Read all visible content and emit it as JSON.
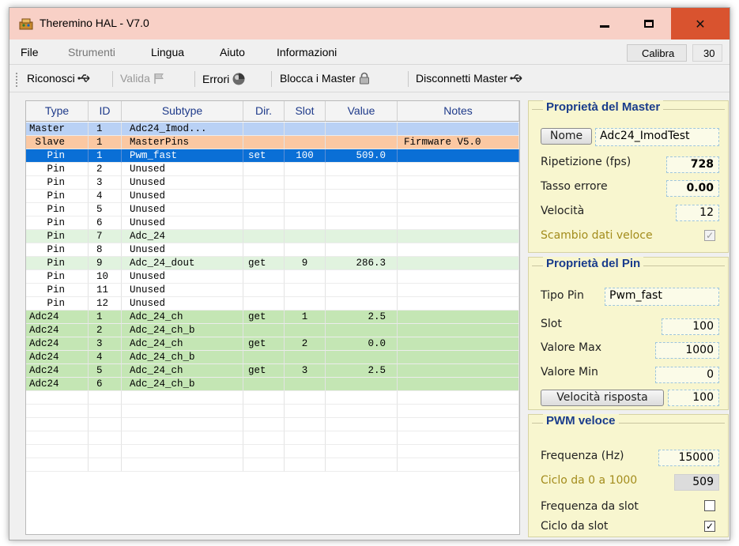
{
  "window": {
    "title": "Theremino HAL - V7.0"
  },
  "menu": {
    "items": [
      "File",
      "Strumenti",
      "Lingua",
      "Aiuto",
      "Informazioni"
    ],
    "calibra_label": "Calibra",
    "calibra_value": "30"
  },
  "toolbar": {
    "riconosci": "Riconosci",
    "valida": "Valida",
    "errori": "Errori",
    "blocca": "Blocca i Master",
    "disconnetti": "Disconnetti Master"
  },
  "table": {
    "headers": [
      "Type",
      "ID",
      "Subtype",
      "Dir.",
      "Slot",
      "Value",
      "Notes"
    ],
    "rows": [
      [
        "Master",
        "1",
        "Adc24_Imod...",
        "",
        "",
        "",
        ""
      ],
      [
        " Slave",
        "1",
        "MasterPins",
        "",
        "",
        "",
        "Firmware V5.0"
      ],
      [
        "   Pin",
        "1",
        "Pwm_fast",
        "set",
        "100",
        "509.0",
        ""
      ],
      [
        "   Pin",
        "2",
        "Unused",
        "",
        "",
        "",
        ""
      ],
      [
        "   Pin",
        "3",
        "Unused",
        "",
        "",
        "",
        ""
      ],
      [
        "   Pin",
        "4",
        "Unused",
        "",
        "",
        "",
        ""
      ],
      [
        "   Pin",
        "5",
        "Unused",
        "",
        "",
        "",
        ""
      ],
      [
        "   Pin",
        "6",
        "Unused",
        "",
        "",
        "",
        ""
      ],
      [
        "   Pin",
        "7",
        "Adc_24",
        "",
        "",
        "",
        ""
      ],
      [
        "   Pin",
        "8",
        "Unused",
        "",
        "",
        "",
        ""
      ],
      [
        "   Pin",
        "9",
        "Adc_24_dout",
        "get",
        "9",
        "286.3",
        ""
      ],
      [
        "   Pin",
        "10",
        "Unused",
        "",
        "",
        "",
        ""
      ],
      [
        "   Pin",
        "11",
        "Unused",
        "",
        "",
        "",
        ""
      ],
      [
        "   Pin",
        "12",
        "Unused",
        "",
        "",
        "",
        ""
      ],
      [
        "Adc24",
        "1",
        "Adc_24_ch",
        "get",
        "1",
        "2.5",
        ""
      ],
      [
        "Adc24",
        "2",
        "Adc_24_ch_b",
        "",
        "",
        "",
        ""
      ],
      [
        "Adc24",
        "3",
        "Adc_24_ch",
        "get",
        "2",
        "0.0",
        ""
      ],
      [
        "Adc24",
        "4",
        "Adc_24_ch_b",
        "",
        "",
        "",
        ""
      ],
      [
        "Adc24",
        "5",
        "Adc_24_ch",
        "get",
        "3",
        "2.5",
        ""
      ],
      [
        "Adc24",
        "6",
        "Adc_24_ch_b",
        "",
        "",
        "",
        ""
      ]
    ],
    "row_colors": [
      "#b9d1f5",
      "#fbc8a2",
      "#0a6fd6",
      "#ffffff",
      "#ffffff",
      "#ffffff",
      "#ffffff",
      "#ffffff",
      "#e1f3df",
      "#ffffff",
      "#e1f3df",
      "#ffffff",
      "#ffffff",
      "#ffffff",
      "#c4e6b4",
      "#c4e6b4",
      "#c4e6b4",
      "#c4e6b4",
      "#c4e6b4",
      "#c4e6b4"
    ],
    "selected_row": 2,
    "empty_rows": 6
  },
  "master_props": {
    "title": "Proprietà del Master",
    "name_button": "Nome",
    "name_value": "Adc24_ImodTest",
    "repetition_label": "Ripetizione (fps)",
    "repetition_value": "728",
    "error_label": "Tasso errore",
    "error_value": "0.00",
    "speed_label": "Velocità",
    "speed_value": "12",
    "fast_exchange_label": "Scambio dati veloce",
    "fast_exchange_checked": true
  },
  "pin_props": {
    "title": "Proprietà del Pin",
    "type_label": "Tipo Pin",
    "type_value": "Pwm_fast",
    "slot_label": "Slot",
    "slot_value": "100",
    "max_label": "Valore Max",
    "max_value": "1000",
    "min_label": "Valore Min",
    "min_value": "0",
    "response_button": "Velocità risposta",
    "response_value": "100"
  },
  "pwm": {
    "title": "PWM veloce",
    "freq_label": "Frequenza (Hz)",
    "freq_value": "15000",
    "cycle_label": "Ciclo da 0 a 1000",
    "cycle_value": "509",
    "freq_slot_label": "Frequenza da slot",
    "freq_slot_checked": false,
    "cycle_slot_label": "Ciclo da slot",
    "cycle_slot_checked": true
  },
  "colors": {
    "title_bar": "#f8d0c6",
    "close_button": "#d9532f",
    "group_bg": "#f8f6cf",
    "group_title": "#1a3c8c"
  }
}
